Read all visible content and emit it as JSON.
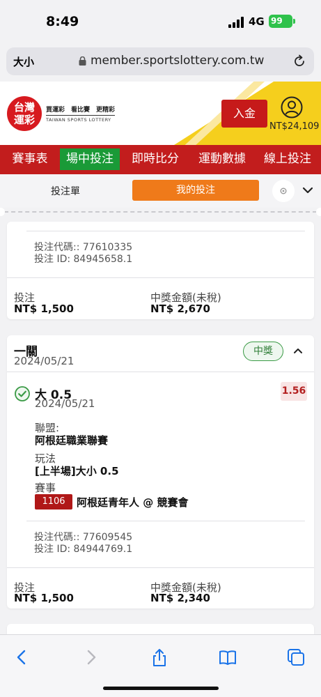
{
  "status_bar": {
    "time": "8:49",
    "network": "4G",
    "battery": "99"
  },
  "browser": {
    "text_size_label": "大小",
    "url": "member.sportslottery.com.tw"
  },
  "site_header": {
    "logo_line1": "台灣",
    "logo_line2": "運彩",
    "slogan": "買運彩　看比賽　更精彩",
    "logo_english": "TAIWAN SPORTS LOTTERY",
    "deposit_label": "入金",
    "balance": "NT$24,109"
  },
  "nav": {
    "items": [
      "賽事表",
      "場中投注",
      "即時比分",
      "運動數據",
      "線上投注"
    ],
    "active_index": 1
  },
  "subtabs": {
    "bet_slip": "投注單",
    "my_bets": "我的投注"
  },
  "bets": [
    {
      "bet_code": "投注代碼:: 77610335",
      "bet_id": "投注 ID: 84945658.1",
      "stake_label": "投注",
      "stake": "NT$ 1,500",
      "payout_label": "中獎金額(未稅)",
      "payout": "NT$ 2,670"
    },
    {
      "leg_type": "一關",
      "date": "2024/05/21",
      "status": "中獎",
      "selection": "大 0.5",
      "selection_date": "2024/05/21",
      "odds": "1.56",
      "league_label": "聯盟:",
      "league": "阿根廷職業聯賽",
      "market_label": "玩法",
      "market": "[上半場]大小 0.5",
      "event_label": "賽事",
      "match_number": "1106",
      "event": "阿根廷青年人 @ 競賽會",
      "bet_code": "投注代碼:: 77609545",
      "bet_id": "投注 ID: 84944769.1",
      "stake_label": "投注",
      "stake": "NT$ 1,500",
      "payout_label": "中獎金額(未稅)",
      "payout": "NT$ 2,340"
    }
  ],
  "colors": {
    "brand_red": "#c21d1d",
    "active_green": "#1a9a37",
    "orange": "#ef7a1a",
    "yellow": "#f5cf1d"
  },
  "toolbar": {
    "icons": [
      "back-icon",
      "forward-icon",
      "share-icon",
      "bookmarks-icon",
      "tabs-icon"
    ]
  }
}
